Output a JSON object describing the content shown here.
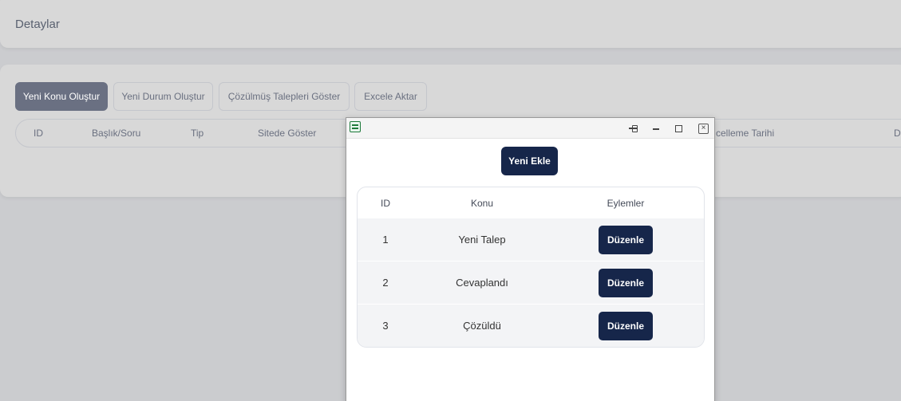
{
  "details_card": {
    "title": "Detaylar"
  },
  "toolbar": {
    "new_topic": "Yeni Konu Oluştur",
    "new_status": "Yeni Durum Oluştur",
    "show_resolved": "Çözülmüş Talepleri Göster",
    "export_excel": "Excele Aktar"
  },
  "main_table": {
    "headers": [
      "ID",
      "Başlık/Soru",
      "Tip",
      "Sitede Göster",
      "celleme Tarihi",
      "D"
    ]
  },
  "popup": {
    "add_button": "Yeni Ekle",
    "headers": {
      "id": "ID",
      "topic": "Konu",
      "actions": "Eylemler"
    },
    "rows": [
      {
        "id": "1",
        "topic": "Yeni Talep",
        "action": "Düzenle"
      },
      {
        "id": "2",
        "topic": "Cevaplandı",
        "action": "Düzenle"
      },
      {
        "id": "3",
        "topic": "Çözüldü",
        "action": "Düzenle"
      }
    ]
  },
  "colors": {
    "primary_dark": "#16264a",
    "primary_button": "#6a7082",
    "background": "#cbcccf"
  }
}
